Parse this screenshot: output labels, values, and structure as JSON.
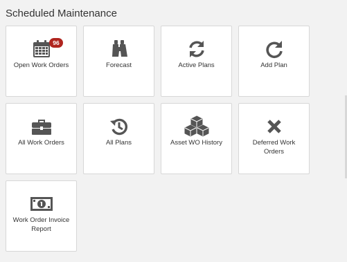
{
  "header": {
    "title": "Scheduled Maintenance"
  },
  "colors": {
    "icon": "#555555",
    "badge": "#b0251f",
    "tile_border": "#d7d7d7",
    "background": "#f2f2f2"
  },
  "tiles": [
    {
      "label": "Open Work Orders",
      "icon": "calendar-icon",
      "badge": "96"
    },
    {
      "label": "Forecast",
      "icon": "binoculars-icon"
    },
    {
      "label": "Active Plans",
      "icon": "refresh-icon"
    },
    {
      "label": "Add Plan",
      "icon": "redo-icon"
    },
    {
      "label": "All Work Orders",
      "icon": "briefcase-icon"
    },
    {
      "label": "All Plans",
      "icon": "history-icon"
    },
    {
      "label": "Asset WO History",
      "icon": "cubes-icon"
    },
    {
      "label": "Deferred Work Orders",
      "icon": "close-icon"
    },
    {
      "label": "Work Order Invoice Report",
      "icon": "money-icon"
    }
  ]
}
